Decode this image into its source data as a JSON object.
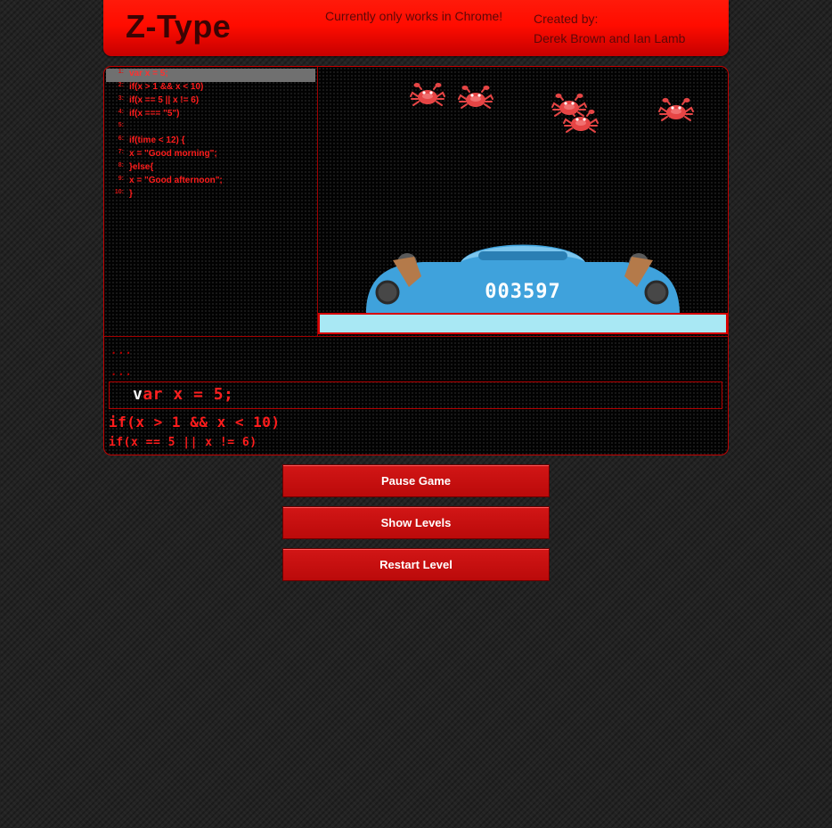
{
  "header": {
    "title": "Z-Type",
    "notice": "Currently only works in Chrome!",
    "credits_label": "Created by:",
    "credits_names": "Derek Brown and Ian Lamb"
  },
  "code_panel": {
    "lines": [
      {
        "num": "1:",
        "text": "var x = 5;"
      },
      {
        "num": "2:",
        "text": "if(x > 1 && x < 10)"
      },
      {
        "num": "3:",
        "text": "if(x == 5 || x != 6)"
      },
      {
        "num": "4:",
        "text": "if(x === \"5\")"
      },
      {
        "num": "5:",
        "text": ""
      },
      {
        "num": "6:",
        "text": "if(time < 12) {"
      },
      {
        "num": "7:",
        "text": "x = \"Good morning\";"
      },
      {
        "num": "8:",
        "text": "}else{"
      },
      {
        "num": "9:",
        "text": "x = \"Good afternoon\";"
      },
      {
        "num": "10:",
        "text": "}"
      }
    ]
  },
  "game": {
    "score": "003597",
    "enemy_count": 5,
    "enemy_icon": "crab-icon",
    "ship_icon": "ship-icon"
  },
  "terminal": {
    "ellipsis_1": "...",
    "ellipsis_2": "...",
    "current_typed": "v",
    "current_remaining": "ar x = 5;",
    "next_line_1": "if(x > 1 && x < 10)",
    "next_line_2": "if(x == 5 || x != 6)"
  },
  "buttons": {
    "pause": "Pause Game",
    "levels": "Show Levels",
    "restart": "Restart Level"
  },
  "colors": {
    "accent": "#ff0c00",
    "code_text": "#ff1c1c",
    "input_bar": "#a9e8f4",
    "ship": "#3fa2dc",
    "enemy": "#e64545"
  }
}
